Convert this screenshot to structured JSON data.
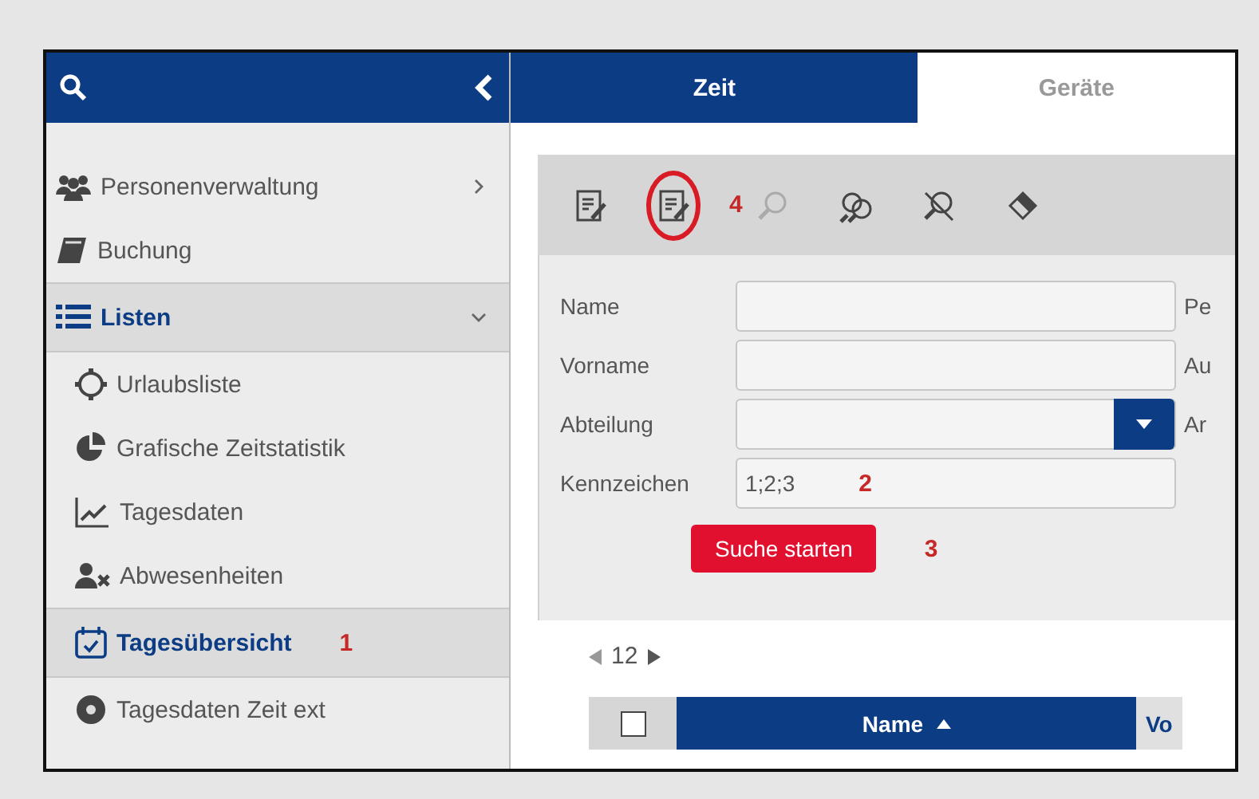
{
  "sidebar": {
    "items": [
      {
        "label": "Personenverwaltung",
        "expanded": false,
        "selected": false
      },
      {
        "label": "Buchung",
        "selected": false
      },
      {
        "label": "Listen",
        "expanded": true,
        "children": [
          {
            "label": "Urlaubsliste",
            "selected": false
          },
          {
            "label": "Grafische Zeitstatistik",
            "selected": false
          },
          {
            "label": "Tagesdaten",
            "selected": false
          },
          {
            "label": "Abwesenheiten",
            "selected": false
          },
          {
            "label": "Tagesübersicht",
            "selected": true,
            "annotation": "1"
          },
          {
            "label": "Tagesdaten Zeit ext",
            "selected": false
          }
        ]
      }
    ]
  },
  "tabs": [
    {
      "label": "Zeit",
      "selected": true
    },
    {
      "label": "Geräte",
      "selected": false
    }
  ],
  "toolbar": {
    "tools": [
      {
        "kind": "edit",
        "circled": false,
        "disabled": false
      },
      {
        "kind": "edit",
        "circled": true,
        "disabled": false
      },
      {
        "kind": "search",
        "circled": false,
        "disabled": true,
        "annotation": "4"
      },
      {
        "kind": "search-multi",
        "circled": false,
        "disabled": false
      },
      {
        "kind": "search-clear",
        "circled": false,
        "disabled": false
      },
      {
        "kind": "eraser",
        "circled": false,
        "disabled": false
      }
    ]
  },
  "form": {
    "fields": [
      {
        "label": "Name",
        "kind": "text",
        "side_label": "Pe"
      },
      {
        "label": "Vorname",
        "kind": "text",
        "side_label": "Au"
      },
      {
        "label": "Abteilung",
        "kind": "dropdown",
        "side_label": "Ar"
      },
      {
        "label": "Kennzeichen",
        "kind": "text",
        "value": "1;2;3",
        "annotation": "2"
      }
    ],
    "search_button": {
      "label": "Suche starten",
      "annotation": "3"
    }
  },
  "pager": {
    "page": "12"
  },
  "table": {
    "select_all": {
      "checked": false
    },
    "columns": [
      {
        "label": "Name",
        "sorted": true,
        "selected": true
      },
      {
        "label": "Vo",
        "selected": false
      }
    ]
  }
}
